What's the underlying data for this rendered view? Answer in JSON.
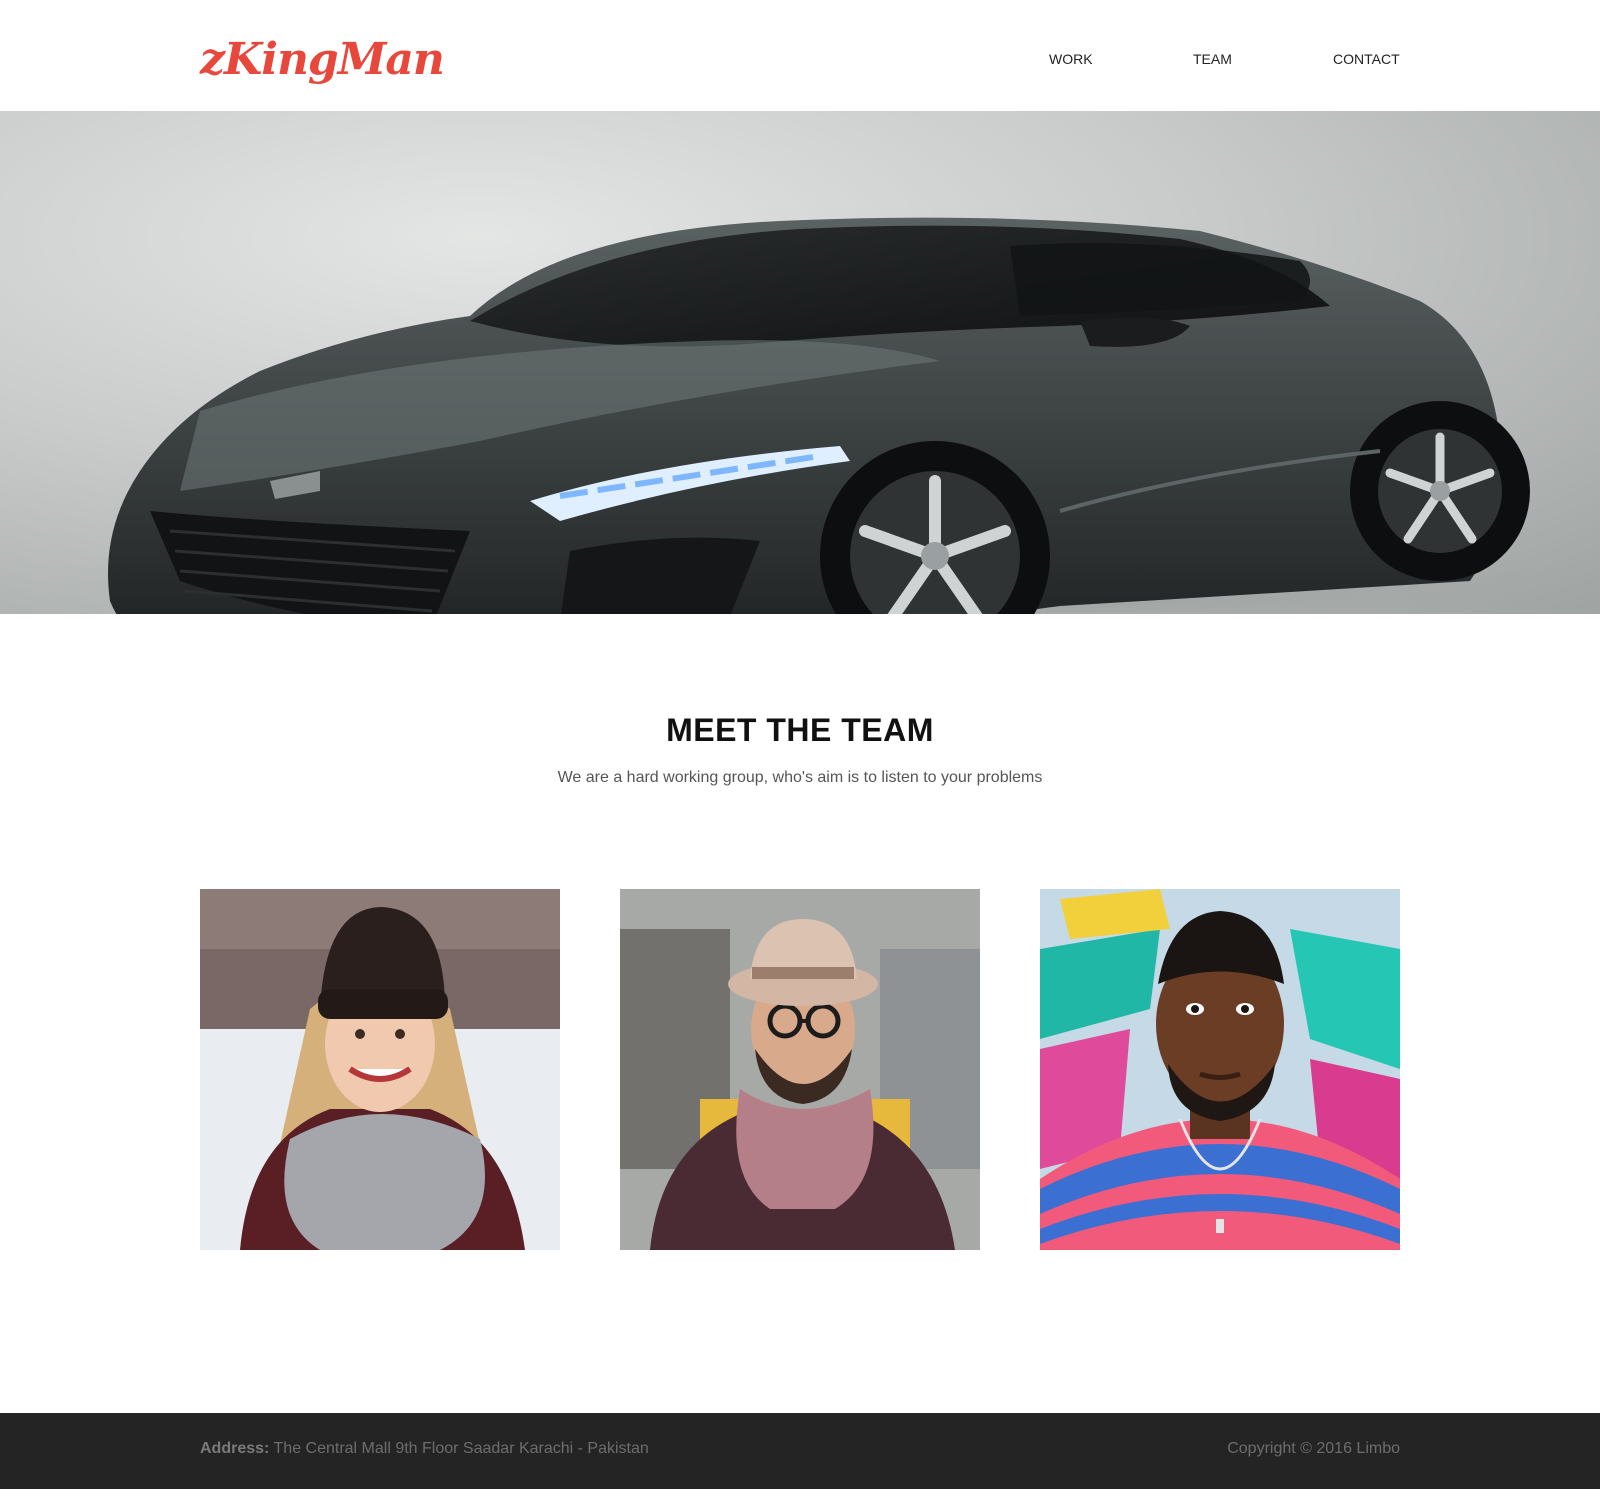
{
  "brand": {
    "logo_text": "zKingMan",
    "accent_color": "#e8473b"
  },
  "nav": {
    "items": [
      "WORK",
      "TEAM",
      "CONTACT"
    ]
  },
  "hero": {
    "image": "sports-car-photo"
  },
  "team": {
    "title": "MEET THE TEAM",
    "subtitle": "We are a hard working group, who's aim is to listen to your problems",
    "members": [
      "woman-in-beanie-photo",
      "man-in-hat-photo",
      "man-graffiti-photo"
    ]
  },
  "footer": {
    "address_label": "Address:",
    "address_text": "The Central Mall 9th Floor Saadar Karachi - Pakistan",
    "copyright": "Copyright © 2016 Limbo",
    "background": "#242424"
  }
}
